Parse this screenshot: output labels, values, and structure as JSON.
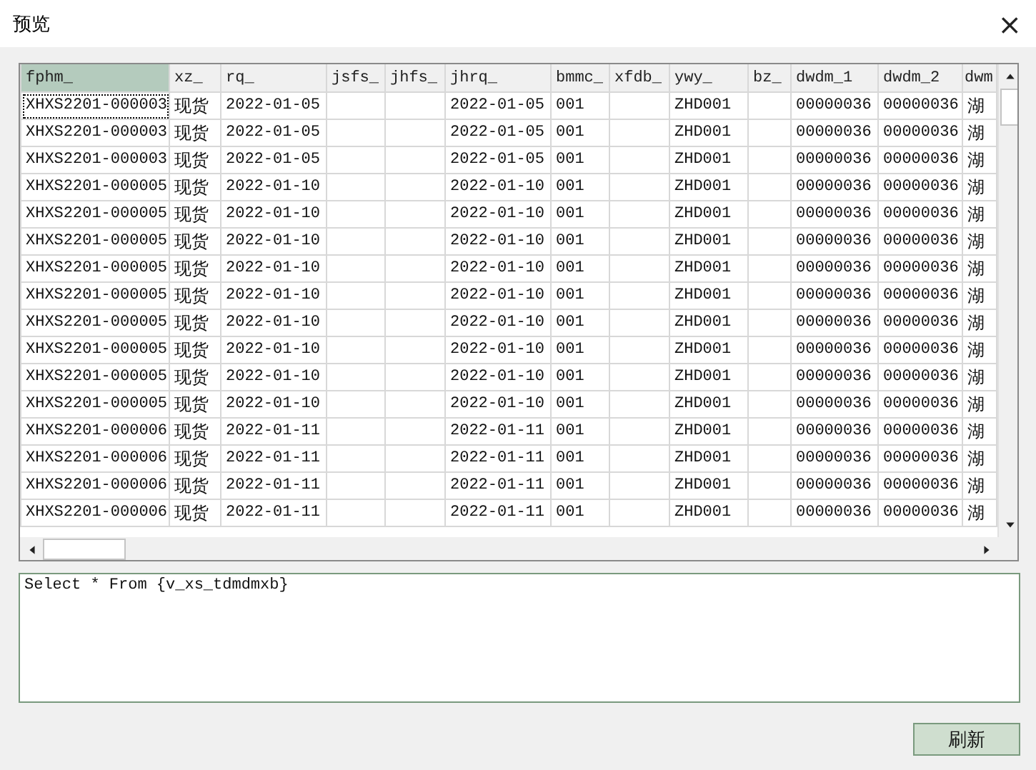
{
  "window": {
    "title": "预览",
    "close": "×"
  },
  "table": {
    "columns": [
      {
        "label": "fphm_",
        "selected": true
      },
      {
        "label": "xz_",
        "selected": false
      },
      {
        "label": "rq_",
        "selected": false
      },
      {
        "label": "jsfs_",
        "selected": false
      },
      {
        "label": "jhfs_",
        "selected": false
      },
      {
        "label": "jhrq_",
        "selected": false
      },
      {
        "label": "bmmc_",
        "selected": false
      },
      {
        "label": "xfdb_",
        "selected": false
      },
      {
        "label": "ywy_",
        "selected": false
      },
      {
        "label": "bz_",
        "selected": false
      },
      {
        "label": "dwdm_1",
        "selected": false
      },
      {
        "label": "dwdm_2",
        "selected": false
      },
      {
        "label": "dwm",
        "selected": false
      }
    ],
    "rows": [
      {
        "focused": true,
        "cells": [
          "XHXS2201-000003",
          "现货",
          "2022-01-05",
          null,
          null,
          "2022-01-05",
          "001",
          null,
          "ZHD001",
          null,
          "00000036",
          "00000036",
          "湖"
        ]
      },
      {
        "focused": false,
        "cells": [
          "XHXS2201-000003",
          "现货",
          "2022-01-05",
          null,
          null,
          "2022-01-05",
          "001",
          null,
          "ZHD001",
          null,
          "00000036",
          "00000036",
          "湖"
        ]
      },
      {
        "focused": false,
        "cells": [
          "XHXS2201-000003",
          "现货",
          "2022-01-05",
          null,
          null,
          "2022-01-05",
          "001",
          null,
          "ZHD001",
          null,
          "00000036",
          "00000036",
          "湖"
        ]
      },
      {
        "focused": false,
        "cells": [
          "XHXS2201-000005",
          "现货",
          "2022-01-10",
          null,
          null,
          "2022-01-10",
          "001",
          null,
          "ZHD001",
          null,
          "00000036",
          "00000036",
          "湖"
        ]
      },
      {
        "focused": false,
        "cells": [
          "XHXS2201-000005",
          "现货",
          "2022-01-10",
          null,
          null,
          "2022-01-10",
          "001",
          null,
          "ZHD001",
          null,
          "00000036",
          "00000036",
          "湖"
        ]
      },
      {
        "focused": false,
        "cells": [
          "XHXS2201-000005",
          "现货",
          "2022-01-10",
          null,
          null,
          "2022-01-10",
          "001",
          null,
          "ZHD001",
          null,
          "00000036",
          "00000036",
          "湖"
        ]
      },
      {
        "focused": false,
        "cells": [
          "XHXS2201-000005",
          "现货",
          "2022-01-10",
          null,
          null,
          "2022-01-10",
          "001",
          null,
          "ZHD001",
          null,
          "00000036",
          "00000036",
          "湖"
        ]
      },
      {
        "focused": false,
        "cells": [
          "XHXS2201-000005",
          "现货",
          "2022-01-10",
          null,
          null,
          "2022-01-10",
          "001",
          null,
          "ZHD001",
          null,
          "00000036",
          "00000036",
          "湖"
        ]
      },
      {
        "focused": false,
        "cells": [
          "XHXS2201-000005",
          "现货",
          "2022-01-10",
          null,
          null,
          "2022-01-10",
          "001",
          null,
          "ZHD001",
          null,
          "00000036",
          "00000036",
          "湖"
        ]
      },
      {
        "focused": false,
        "cells": [
          "XHXS2201-000005",
          "现货",
          "2022-01-10",
          null,
          null,
          "2022-01-10",
          "001",
          null,
          "ZHD001",
          null,
          "00000036",
          "00000036",
          "湖"
        ]
      },
      {
        "focused": false,
        "cells": [
          "XHXS2201-000005",
          "现货",
          "2022-01-10",
          null,
          null,
          "2022-01-10",
          "001",
          null,
          "ZHD001",
          null,
          "00000036",
          "00000036",
          "湖"
        ]
      },
      {
        "focused": false,
        "cells": [
          "XHXS2201-000005",
          "现货",
          "2022-01-10",
          null,
          null,
          "2022-01-10",
          "001",
          null,
          "ZHD001",
          null,
          "00000036",
          "00000036",
          "湖"
        ]
      },
      {
        "focused": false,
        "cells": [
          "XHXS2201-000006",
          "现货",
          "2022-01-11",
          null,
          null,
          "2022-01-11",
          "001",
          null,
          "ZHD001",
          null,
          "00000036",
          "00000036",
          "湖"
        ]
      },
      {
        "focused": false,
        "cells": [
          "XHXS2201-000006",
          "现货",
          "2022-01-11",
          null,
          null,
          "2022-01-11",
          "001",
          null,
          "ZHD001",
          null,
          "00000036",
          "00000036",
          "湖"
        ]
      },
      {
        "focused": false,
        "cells": [
          "XHXS2201-000006",
          "现货",
          "2022-01-11",
          null,
          null,
          "2022-01-11",
          "001",
          null,
          "ZHD001",
          null,
          "00000036",
          "00000036",
          "湖"
        ]
      },
      {
        "focused": false,
        "cells": [
          "XHXS2201-000006",
          "现货",
          "2022-01-11",
          null,
          null,
          "2022-01-11",
          "001",
          null,
          "ZHD001",
          null,
          "00000036",
          "00000036",
          "湖"
        ]
      }
    ]
  },
  "query": {
    "value": "Select * From {v_xs_tdmdmxb}"
  },
  "buttons": [
    {
      "label": "刷新"
    }
  ]
}
